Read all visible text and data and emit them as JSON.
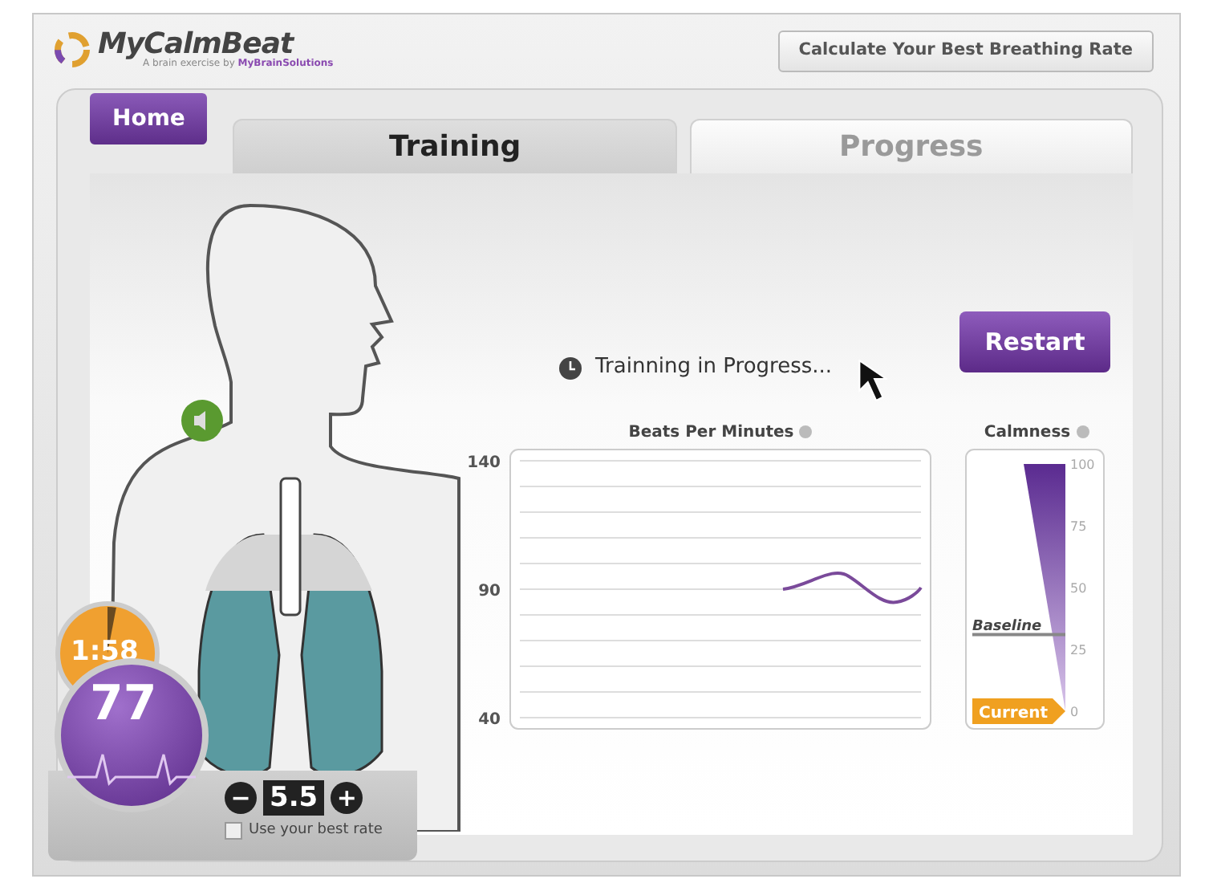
{
  "header": {
    "logo": "MyCalmBeat",
    "tagline_prefix": "A brain exercise by ",
    "tagline_brand": "MyBrainSolutions",
    "calc_button": "Calculate Your Best Breathing Rate"
  },
  "home_button": "Home",
  "tabs": [
    {
      "label": "Training",
      "selected": true
    },
    {
      "label": "Progress",
      "selected": false
    }
  ],
  "status": {
    "text": "Trainning in Progress..."
  },
  "restart_button": "Restart",
  "bpm_chart": {
    "title": "Beats Per Minutes",
    "axis_labels": [
      "140",
      "90",
      "40"
    ]
  },
  "calmness": {
    "title": "Calmness",
    "scale": [
      "100",
      "75",
      "50",
      "25",
      "0"
    ],
    "baseline": {
      "label": "Baseline",
      "level": 0.31
    },
    "current": {
      "label": "Current",
      "level": 0
    }
  },
  "timer": {
    "text": "1:58",
    "level": 0.03
  },
  "heart_rate": {
    "value": "77"
  },
  "rate_stepper": {
    "minus": "−",
    "value": "5.5",
    "plus": "+"
  },
  "best_rate": {
    "label": "Use your best rate",
    "checked": false
  }
}
